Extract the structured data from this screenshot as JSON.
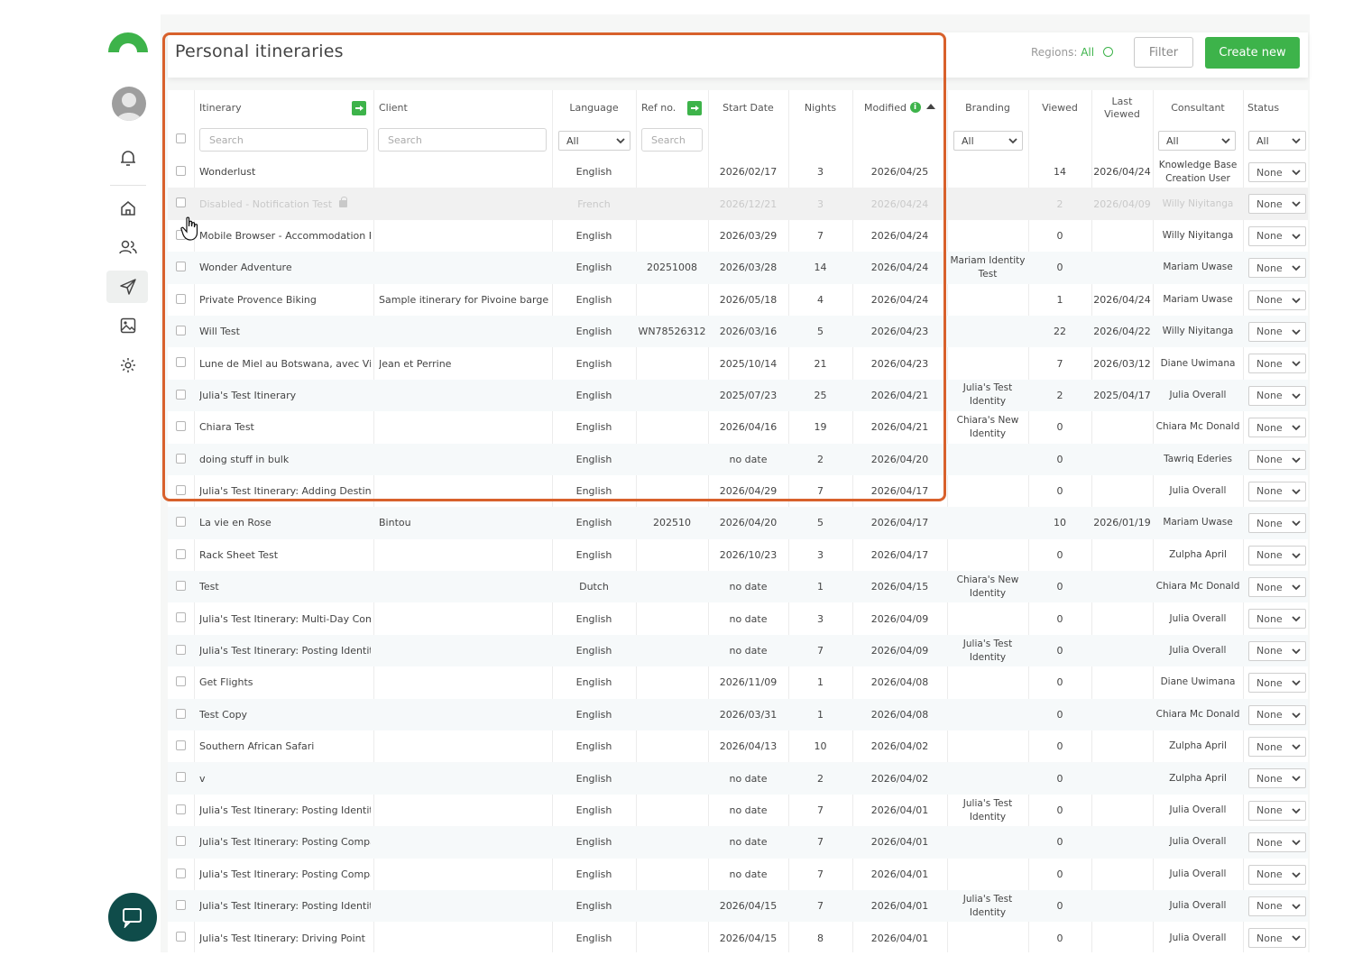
{
  "header": {
    "title": "Personal itineraries",
    "regions_label": "Regions:",
    "regions_value": "All",
    "filter_label": "Filter",
    "create_label": "Create new"
  },
  "columns": {
    "itinerary": "Itinerary",
    "client": "Client",
    "language": "Language",
    "ref": "Ref no.",
    "start": "Start Date",
    "nights": "Nights",
    "modified": "Modified",
    "branding": "Branding",
    "viewed": "Viewed",
    "last_viewed": "Last Viewed",
    "consultant": "Consultant",
    "status": "Status"
  },
  "filters": {
    "itinerary_placeholder": "Search",
    "client_placeholder": "Search",
    "language_value": "All",
    "ref_placeholder": "Search",
    "branding_value": "All",
    "consultant_value": "All",
    "status_value": "All"
  },
  "colors": {
    "accent": "#3db34a",
    "highlight": "#d8612c",
    "chat": "#0f4c4a"
  },
  "icons": [
    "logo-icon",
    "avatar-icon",
    "bell-icon",
    "home-icon",
    "users-icon",
    "send-icon",
    "image-icon",
    "gear-icon",
    "chat-icon",
    "export-icon",
    "lock-icon",
    "chevron-down-icon",
    "cursor-icon"
  ],
  "rows": [
    {
      "itinerary": "Wonderlust",
      "client": "",
      "language": "English",
      "ref": "",
      "start": "2026/02/17",
      "nights": "3",
      "modified": "2026/04/25",
      "branding": "",
      "viewed": "14",
      "last_viewed": "2026/04/24",
      "consultant": "Knowledge Base Creation User",
      "status": "None"
    },
    {
      "itinerary": "Disabled - Notification Test",
      "client": "",
      "language": "French",
      "ref": "",
      "start": "2026/12/21",
      "nights": "3",
      "modified": "2026/04/24",
      "branding": "",
      "viewed": "2",
      "last_viewed": "2026/04/09",
      "consultant": "Willy Niyitanga",
      "status": "None",
      "disabled": true
    },
    {
      "itinerary": "Mobile Browser - Accommodation Roo...",
      "client": "",
      "language": "English",
      "ref": "",
      "start": "2026/03/29",
      "nights": "7",
      "modified": "2026/04/24",
      "branding": "",
      "viewed": "0",
      "last_viewed": "",
      "consultant": "Willy Niyitanga",
      "status": "None"
    },
    {
      "itinerary": "Wonder Adventure",
      "client": "",
      "language": "English",
      "ref": "20251008",
      "start": "2026/03/28",
      "nights": "14",
      "modified": "2026/04/24",
      "branding": "Mariam Identity Test",
      "viewed": "0",
      "last_viewed": "",
      "consultant": "Mariam Uwase",
      "status": "None"
    },
    {
      "itinerary": "Private Provence Biking",
      "client": "Sample itinerary for Pivoine barge",
      "language": "English",
      "ref": "",
      "start": "2026/05/18",
      "nights": "4",
      "modified": "2026/04/24",
      "branding": "",
      "viewed": "1",
      "last_viewed": "2026/04/24",
      "consultant": "Mariam Uwase",
      "status": "None"
    },
    {
      "itinerary": "Will Test",
      "client": "",
      "language": "English",
      "ref": "WN78526312",
      "start": "2026/03/16",
      "nights": "5",
      "modified": "2026/04/23",
      "branding": "",
      "viewed": "22",
      "last_viewed": "2026/04/22",
      "consultant": "Willy Niyitanga",
      "status": "None"
    },
    {
      "itinerary": "Lune de Miel au Botswana, avec Victor...",
      "client": "Jean et Perrine",
      "language": "English",
      "ref": "",
      "start": "2025/10/14",
      "nights": "21",
      "modified": "2026/04/23",
      "branding": "",
      "viewed": "7",
      "last_viewed": "2026/03/12",
      "consultant": "Diane Uwimana",
      "status": "None"
    },
    {
      "itinerary": "Julia's Test Itinerary",
      "client": "",
      "language": "English",
      "ref": "",
      "start": "2025/07/23",
      "nights": "25",
      "modified": "2026/04/21",
      "branding": "Julia's Test Identity",
      "viewed": "2",
      "last_viewed": "2025/04/17",
      "consultant": "Julia Overall",
      "status": "None"
    },
    {
      "itinerary": "Chiara Test",
      "client": "",
      "language": "English",
      "ref": "",
      "start": "2026/04/16",
      "nights": "19",
      "modified": "2026/04/21",
      "branding": "Chiara's New Identity",
      "viewed": "0",
      "last_viewed": "",
      "consultant": "Chiara Mc Donald",
      "status": "None"
    },
    {
      "itinerary": "doing stuff in bulk",
      "client": "",
      "language": "English",
      "ref": "",
      "start": "no date",
      "nights": "2",
      "modified": "2026/04/20",
      "branding": "",
      "viewed": "0",
      "last_viewed": "",
      "consultant": "Tawriq Ederies",
      "status": "None"
    },
    {
      "itinerary": "Julia's Test Itinerary: Adding Destinati...",
      "client": "",
      "language": "English",
      "ref": "",
      "start": "2026/04/29",
      "nights": "7",
      "modified": "2026/04/17",
      "branding": "",
      "viewed": "0",
      "last_viewed": "",
      "consultant": "Julia Overall",
      "status": "None"
    },
    {
      "itinerary": "La vie en Rose",
      "client": "Bintou",
      "language": "English",
      "ref": "202510",
      "start": "2026/04/20",
      "nights": "5",
      "modified": "2026/04/17",
      "branding": "",
      "viewed": "10",
      "last_viewed": "2026/01/19",
      "consultant": "Mariam Uwase",
      "status": "None"
    },
    {
      "itinerary": "Rack Sheet Test",
      "client": "",
      "language": "English",
      "ref": "",
      "start": "2026/10/23",
      "nights": "3",
      "modified": "2026/04/17",
      "branding": "",
      "viewed": "0",
      "last_viewed": "",
      "consultant": "Zulpha April",
      "status": "None"
    },
    {
      "itinerary": "Test",
      "client": "",
      "language": "Dutch",
      "ref": "",
      "start": "no date",
      "nights": "1",
      "modified": "2026/04/15",
      "branding": "Chiara's New Identity",
      "viewed": "0",
      "last_viewed": "",
      "consultant": "Chiara Mc Donald",
      "status": "None"
    },
    {
      "itinerary": "Julia's Test Itinerary: Multi-Day Comp...",
      "client": "",
      "language": "English",
      "ref": "",
      "start": "no date",
      "nights": "3",
      "modified": "2026/04/09",
      "branding": "",
      "viewed": "0",
      "last_viewed": "",
      "consultant": "Julia Overall",
      "status": "None"
    },
    {
      "itinerary": "Julia's Test Itinerary: Posting Identity ...",
      "client": "",
      "language": "English",
      "ref": "",
      "start": "no date",
      "nights": "7",
      "modified": "2026/04/09",
      "branding": "Julia's Test Identity",
      "viewed": "0",
      "last_viewed": "",
      "consultant": "Julia Overall",
      "status": "None"
    },
    {
      "itinerary": "Get Flights",
      "client": "",
      "language": "English",
      "ref": "",
      "start": "2026/11/09",
      "nights": "1",
      "modified": "2026/04/08",
      "branding": "",
      "viewed": "0",
      "last_viewed": "",
      "consultant": "Diane Uwimana",
      "status": "None"
    },
    {
      "itinerary": "Test Copy",
      "client": "",
      "language": "English",
      "ref": "",
      "start": "2026/03/31",
      "nights": "1",
      "modified": "2026/04/08",
      "branding": "",
      "viewed": "0",
      "last_viewed": "",
      "consultant": "Chiara Mc Donald",
      "status": "None"
    },
    {
      "itinerary": "Southern African Safari",
      "client": "",
      "language": "English",
      "ref": "",
      "start": "2026/04/13",
      "nights": "10",
      "modified": "2026/04/02",
      "branding": "",
      "viewed": "0",
      "last_viewed": "",
      "consultant": "Zulpha April",
      "status": "None"
    },
    {
      "itinerary": "v",
      "client": "",
      "language": "English",
      "ref": "",
      "start": "no date",
      "nights": "2",
      "modified": "2026/04/02",
      "branding": "",
      "viewed": "0",
      "last_viewed": "",
      "consultant": "Zulpha April",
      "status": "None"
    },
    {
      "itinerary": "Julia's Test Itinerary: Posting Identity ...",
      "client": "",
      "language": "English",
      "ref": "",
      "start": "no date",
      "nights": "7",
      "modified": "2026/04/01",
      "branding": "Julia's Test Identity",
      "viewed": "0",
      "last_viewed": "",
      "consultant": "Julia Overall",
      "status": "None"
    },
    {
      "itinerary": "Julia's Test Itinerary: Posting Company...",
      "client": "",
      "language": "English",
      "ref": "",
      "start": "no date",
      "nights": "7",
      "modified": "2026/04/01",
      "branding": "",
      "viewed": "0",
      "last_viewed": "",
      "consultant": "Julia Overall",
      "status": "None"
    },
    {
      "itinerary": "Julia's Test Itinerary: Posting Company...",
      "client": "",
      "language": "English",
      "ref": "",
      "start": "no date",
      "nights": "7",
      "modified": "2026/04/01",
      "branding": "",
      "viewed": "0",
      "last_viewed": "",
      "consultant": "Julia Overall",
      "status": "None"
    },
    {
      "itinerary": "Julia's Test Itinerary: Posting Identity",
      "client": "",
      "language": "English",
      "ref": "",
      "start": "2026/04/15",
      "nights": "7",
      "modified": "2026/04/01",
      "branding": "Julia's Test Identity",
      "viewed": "0",
      "last_viewed": "",
      "consultant": "Julia Overall",
      "status": "None"
    },
    {
      "itinerary": "Julia's Test Itinerary: Driving Point",
      "client": "",
      "language": "English",
      "ref": "",
      "start": "2026/04/15",
      "nights": "8",
      "modified": "2026/04/01",
      "branding": "",
      "viewed": "0",
      "last_viewed": "",
      "consultant": "Julia Overall",
      "status": "None"
    }
  ]
}
